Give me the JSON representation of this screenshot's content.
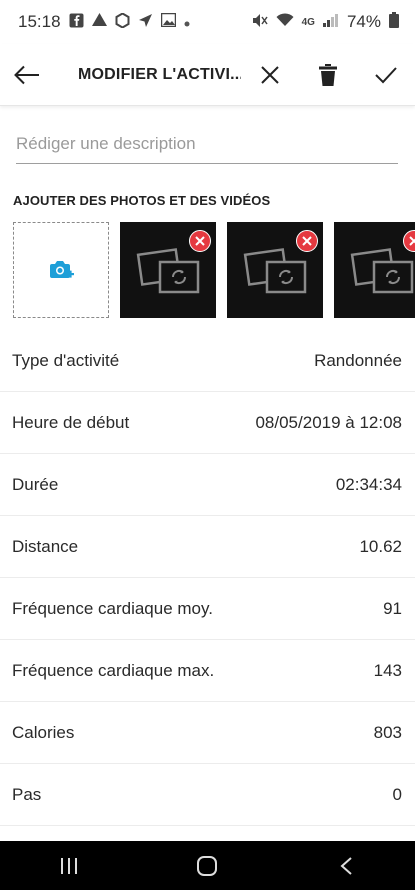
{
  "status_bar": {
    "time": "15:18",
    "left_icons": [
      "facebook-icon",
      "drive-icon",
      "app-icon",
      "navigation-icon",
      "gallery-icon",
      "dot-icon"
    ],
    "right_icons": [
      "mute-icon",
      "wifi-icon",
      "4g-icon",
      "signal-icon"
    ],
    "network": "4G",
    "battery": "74%"
  },
  "toolbar": {
    "title": "MODIFIER L'ACTIVI...",
    "back_icon": "arrow-left-icon",
    "close_icon": "close-icon",
    "delete_icon": "trash-icon",
    "save_icon": "check-icon"
  },
  "description": {
    "placeholder": "Rédiger une description",
    "value": ""
  },
  "photos": {
    "label": "AJOUTER DES PHOTOS ET DES VIDÉOS",
    "add_icon": "add-camera-icon",
    "thumbnails": [
      {
        "icon": "image-placeholder-icon"
      },
      {
        "icon": "image-placeholder-icon"
      },
      {
        "icon": "image-placeholder-icon"
      }
    ]
  },
  "fields": [
    {
      "label": "Type d'activité",
      "value": "Randonnée"
    },
    {
      "label": "Heure de début",
      "value": "08/05/2019 à 12:08"
    },
    {
      "label": "Durée",
      "value": "02:34:34"
    },
    {
      "label": "Distance",
      "value": "10.62"
    },
    {
      "label": "Fréquence cardiaque moy.",
      "value": "91"
    },
    {
      "label": "Fréquence cardiaque max.",
      "value": "143"
    },
    {
      "label": "Calories",
      "value": "803"
    },
    {
      "label": "Pas",
      "value": "0"
    }
  ],
  "colors": {
    "accent": "#1e9fd8",
    "remove": "#e53940",
    "thumb_bg": "#111111"
  },
  "nav_bar": {
    "recents_icon": "recents-icon",
    "home_icon": "home-icon",
    "back_icon": "back-icon"
  }
}
